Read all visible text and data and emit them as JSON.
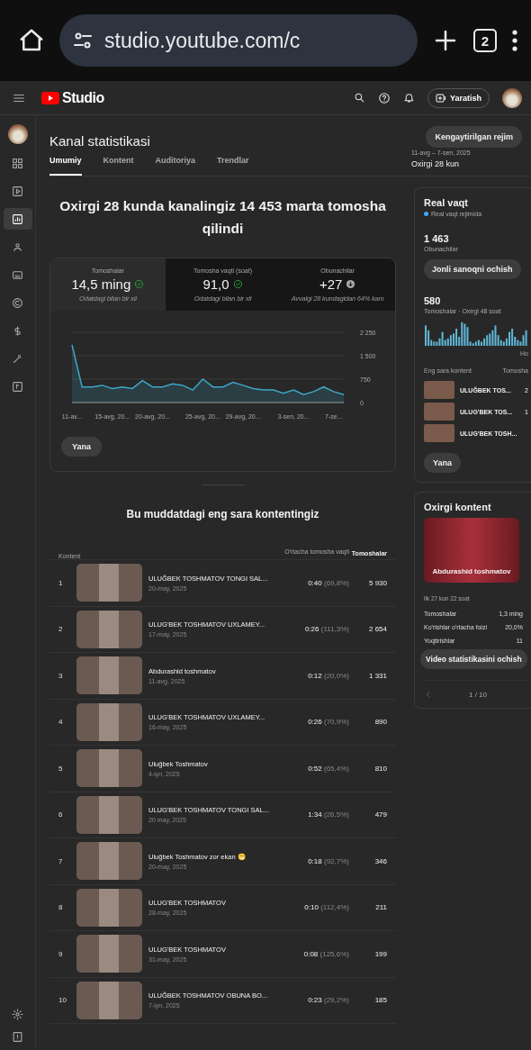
{
  "browser": {
    "url": "studio.youtube.com/c",
    "tab_count": "2"
  },
  "header": {
    "logo": "Studio",
    "create_button": "Yaratish"
  },
  "sidebar": {
    "items": [
      {
        "selected": false
      },
      {
        "selected": false
      },
      {
        "selected": true
      },
      {
        "selected": false
      },
      {
        "selected": false
      },
      {
        "selected": false
      },
      {
        "selected": false
      },
      {
        "selected": false
      },
      {
        "selected": false
      }
    ]
  },
  "page": {
    "title": "Kanal statistikasi",
    "advanced_button": "Kengaytirilgan rejim",
    "date_range": "11-avg – 7-sen, 2025",
    "period": "Oxirgi 28 kun"
  },
  "tabs": [
    {
      "label": "Umumiy",
      "selected": true
    },
    {
      "label": "Kontent",
      "selected": false
    },
    {
      "label": "Auditoriya",
      "selected": false
    },
    {
      "label": "Trendlar",
      "selected": false
    }
  ],
  "headline": "Oxirgi 28 kunda kanalingiz 14 453 marta tomosha qilindi",
  "metrics": [
    {
      "label": "Tomoshalar",
      "value": "14,5 ming",
      "kind": "check",
      "note": "Odatdagi bilan bir xil",
      "selected": true
    },
    {
      "label": "Tomosha vaqti (soat)",
      "value": "91,0",
      "kind": "check",
      "note": "Odatdagi bilan bir xil",
      "selected": false
    },
    {
      "label": "Obunachilar",
      "value": "+27",
      "kind": "down",
      "note": "Avvalgi 28 kundagidan 64% kam",
      "selected": false
    }
  ],
  "chart_data": {
    "type": "area",
    "categories": [
      "11-av...",
      null,
      null,
      null,
      "15-avg, 20...",
      null,
      null,
      null,
      "20-avg, 20...",
      null,
      null,
      null,
      null,
      "25-avg, 20...",
      null,
      null,
      null,
      "29-avg, 20...",
      null,
      null,
      null,
      null,
      "3-sen, 20...",
      null,
      null,
      null,
      "7-se...",
      null
    ],
    "series": [
      {
        "color": "#3ea6c8",
        "values": [
          1850,
          500,
          500,
          550,
          450,
          500,
          450,
          700,
          500,
          500,
          600,
          550,
          400,
          750,
          500,
          500,
          650,
          550,
          450,
          400,
          400,
          300,
          400,
          250,
          350,
          500,
          350,
          250
        ]
      }
    ],
    "yticks": [
      {
        "value": 0,
        "label": "0"
      },
      {
        "value": 750,
        "label": "750"
      },
      {
        "value": 1500,
        "label": "1 500"
      },
      {
        "value": 2250,
        "label": "2 250"
      }
    ],
    "ylim": [
      0,
      2250
    ]
  },
  "more_button": "Yana",
  "top_content": {
    "title": "Bu muddatdagi eng sara kontentingiz",
    "columns": [
      "Kontent",
      "O'rtacha tomosha vaqti",
      "Tomoshalar"
    ],
    "rows": [
      {
        "rank": "1",
        "title": "ULUĞBEK TOSHMATOV TONGI SAL...",
        "date": "20-may, 2025",
        "avg": "0:40",
        "pct": "(69,8%)",
        "views": "5 930"
      },
      {
        "rank": "2",
        "title": "ULUG'BEK TOSHMATOV UXLAMEY...",
        "date": "17-may, 2025",
        "avg": "0:26",
        "pct": "(111,3%)",
        "views": "2 654"
      },
      {
        "rank": "3",
        "title": "Abdurashid toshmatov",
        "date": "11-avg, 2025",
        "avg": "0:12",
        "pct": "(20,0%)",
        "views": "1 331"
      },
      {
        "rank": "4",
        "title": "ULUG'BEK TOSHMATOV UXLAMEY...",
        "date": "16-may, 2025",
        "avg": "0:26",
        "pct": "(70,9%)",
        "views": "890"
      },
      {
        "rank": "5",
        "title": "Uluğbek Toshmatov",
        "date": "4-iyn, 2025",
        "avg": "0:52",
        "pct": "(65,4%)",
        "views": "810"
      },
      {
        "rank": "6",
        "title": "ULUG'BEK TOSHMATOV TONGI SAL...",
        "date": "20 may, 2025",
        "avg": "1:34",
        "pct": "(26,5%)",
        "views": "479"
      },
      {
        "rank": "7",
        "title": "Uluğbek Toshmatov zor ekan 😁",
        "date": "20-may, 2025",
        "avg": "0:18",
        "pct": "(92,7%)",
        "views": "346"
      },
      {
        "rank": "8",
        "title": "ULUG'BEK TOSHMATOV",
        "date": "28-may, 2025",
        "avg": "0:10",
        "pct": "(112,4%)",
        "views": "211"
      },
      {
        "rank": "9",
        "title": "ULUG'BEK TOSHMATOV",
        "date": "31-may, 2025",
        "avg": "0:08",
        "pct": "(125,6%)",
        "views": "199"
      },
      {
        "rank": "10",
        "title": "ULUĞBEK TOSHMATOV OBUNA BO...",
        "date": "7-iyn, 2025",
        "avg": "0:23",
        "pct": "(29,2%)",
        "views": "185"
      }
    ]
  },
  "realtime": {
    "title": "Real vaqt",
    "live": "Real vaqt rejimida",
    "subscribers": "1 463",
    "subscribers_label": "Obunachilar",
    "live_button": "Jonli sanoqni ochish",
    "views": "580",
    "views_label": "Tomoshalar · Oxirgi 48 soat",
    "axis_label": "Ho",
    "columns": [
      "Eng sara kontent",
      "Tomosha"
    ],
    "rows": [
      {
        "title": "ULUĞBEK TOS...",
        "views": "2"
      },
      {
        "title": "ULUG'BEK TOS...",
        "views": "1"
      },
      {
        "title": "ULUG'BEK TOSH..."
      }
    ],
    "more_button": "Yana"
  },
  "latest": {
    "title": "Oxirgi kontent",
    "video_title": "Abdurashid toshmatov",
    "age": "ilk 27 kun 22 soat",
    "stats": [
      {
        "label": "Tomoshalar",
        "value": "1,3 ming"
      },
      {
        "label": "Ko'rishlar o'rtacha foizi",
        "value": "20,0%"
      },
      {
        "label": "Yoqtirishlar",
        "value": "11"
      }
    ],
    "button": "Video statistikasini ochish",
    "pager": "1 / 10"
  }
}
